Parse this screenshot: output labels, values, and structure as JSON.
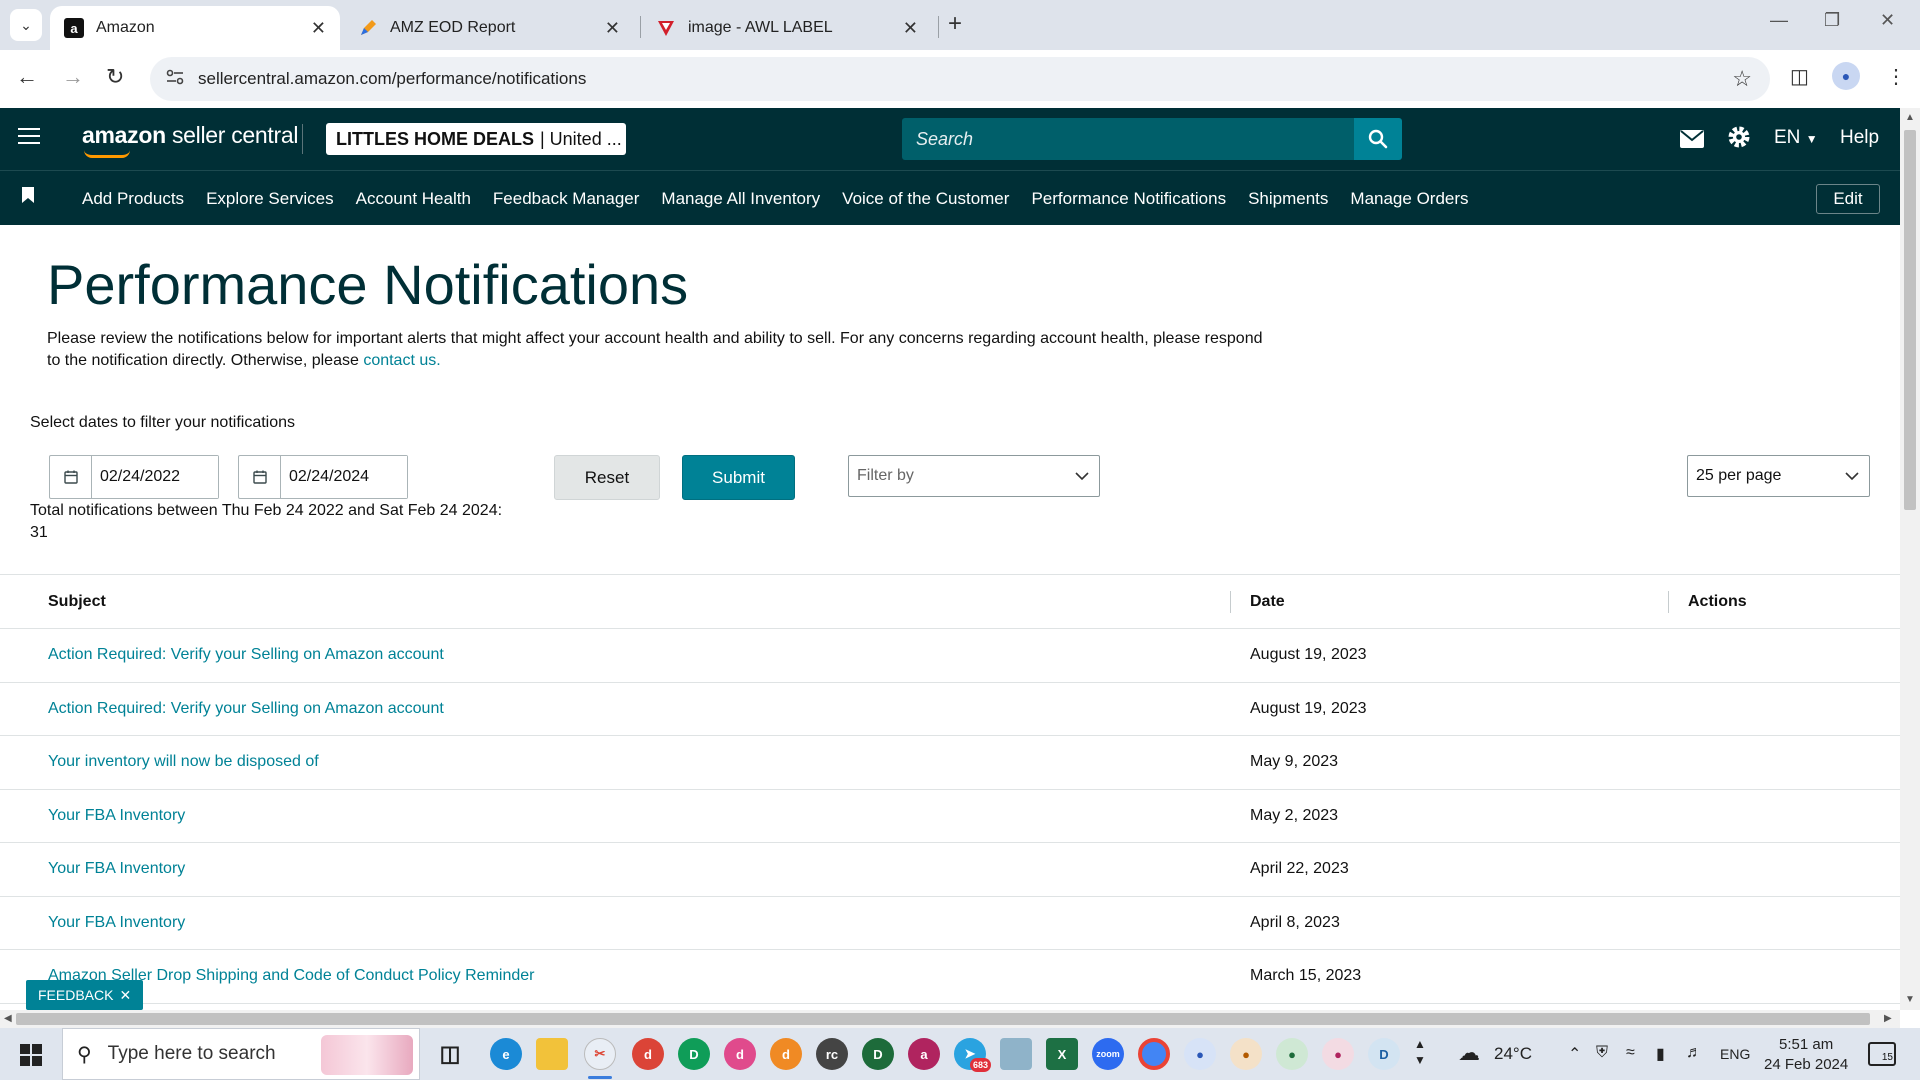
{
  "browser": {
    "tabs": [
      {
        "title": "Amazon",
        "favicon": "a"
      },
      {
        "title": "AMZ EOD Report",
        "favicon": "pen"
      },
      {
        "title": "image - AWL LABEL",
        "favicon": "v"
      }
    ],
    "url": "sellercentral.amazon.com/performance/notifications"
  },
  "header": {
    "logo_brand": "amazon",
    "logo_suffix": "seller central",
    "store_name": "LITTLES HOME DEALS",
    "store_region": "| United ...",
    "search_placeholder": "Search",
    "language": "EN",
    "help": "Help"
  },
  "nav": {
    "items": [
      "Add Products",
      "Explore Services",
      "Account Health",
      "Feedback Manager",
      "Manage All Inventory",
      "Voice of the Customer",
      "Performance Notifications",
      "Shipments",
      "Manage Orders"
    ],
    "edit": "Edit"
  },
  "page": {
    "title": "Performance Notifications",
    "intro": "Please review the notifications below for important alerts that might affect your account health and ability to sell. For any concerns regarding account health, please respond to the notification directly. Otherwise, please",
    "intro_link": "contact us.",
    "filter_label": "Select dates to filter your notifications",
    "start_date": "02/24/2022",
    "end_date": "02/24/2024",
    "total_text": "Total notifications between Thu Feb 24 2022 and Sat Feb 24 2024:",
    "total_count": "31",
    "reset": "Reset",
    "submit": "Submit",
    "filter_placeholder": "Filter by",
    "per_page": "25 per page"
  },
  "table": {
    "headers": {
      "subject": "Subject",
      "date": "Date",
      "actions": "Actions"
    },
    "rows": [
      {
        "subject": "Action Required: Verify your Selling on Amazon account",
        "date": "August 19, 2023"
      },
      {
        "subject": "Action Required: Verify your Selling on Amazon account",
        "date": "August 19, 2023"
      },
      {
        "subject": "Your inventory will now be disposed of",
        "date": "May 9, 2023"
      },
      {
        "subject": "Your FBA Inventory",
        "date": "May 2, 2023"
      },
      {
        "subject": "Your FBA Inventory",
        "date": "April 22, 2023"
      },
      {
        "subject": "Your FBA Inventory",
        "date": "April 8, 2023"
      },
      {
        "subject": "Amazon Seller Drop Shipping and Code of Conduct Policy Reminder",
        "date": "March 15, 2023"
      }
    ]
  },
  "feedback": "FEEDBACK",
  "taskbar": {
    "search_placeholder": "Type here to search",
    "temperature": "24°C",
    "language": "ENG",
    "time": "5:51 am",
    "date": "24 Feb 2024",
    "notification_count": "15",
    "telegram_badge": "683"
  },
  "colors": {
    "header_bg": "#002f36",
    "accent": "#008296",
    "search_bg": "#005f6a",
    "logo_smile": "#ff9900"
  }
}
